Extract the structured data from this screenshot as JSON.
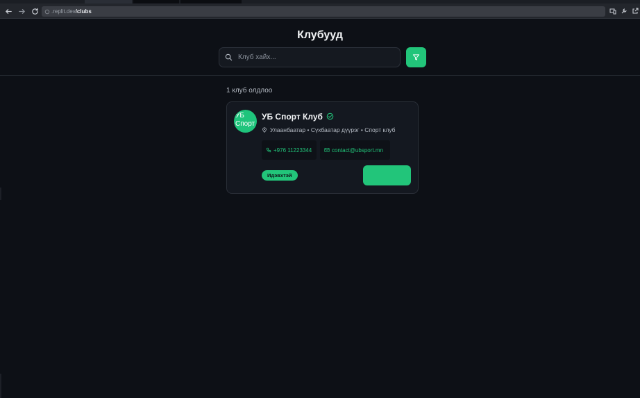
{
  "browser": {
    "url_host": ".replit.dev",
    "url_path": "/clubs"
  },
  "page": {
    "title": "Клубууд"
  },
  "search": {
    "placeholder": "Клуб хайх..."
  },
  "results": {
    "count_text": "1 клуб олдлоо"
  },
  "clubs": [
    {
      "avatar_alt": "УБ Спорт",
      "name": "УБ Спорт Клуб",
      "meta": "Улаанбаатар • Сүхбаатар дүүрэг • Спорт клуб",
      "phone": "+976 11223344",
      "email": "contact@ubsport.mn",
      "status": "Идэвхтэй"
    }
  ],
  "colors": {
    "accent": "#22c57a",
    "background": "#0d1016",
    "card": "#141820"
  },
  "icons": {
    "back": "arrow-left-icon",
    "forward": "arrow-right-icon",
    "reload": "reload-icon",
    "search": "search-icon",
    "filter": "filter-icon",
    "verified": "check-circle-icon",
    "location": "map-pin-icon",
    "phone": "phone-icon",
    "email": "mail-icon"
  }
}
